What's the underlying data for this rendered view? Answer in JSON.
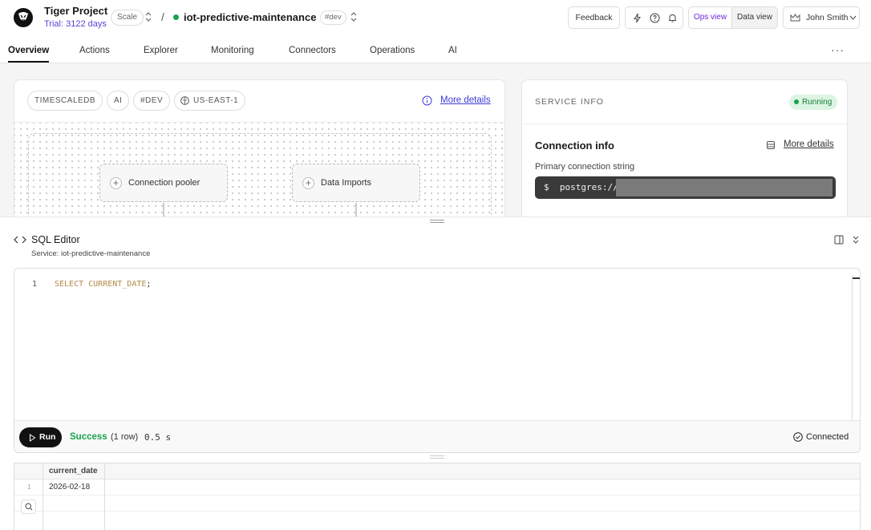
{
  "header": {
    "project_name": "Tiger Project",
    "trial": "Trial: 3122 days",
    "plan": "Scale",
    "separator": "/",
    "service_name": "iot-predictive-maintenance",
    "env": "#dev",
    "feedback_label": "Feedback",
    "ops_view_label": "Ops view",
    "data_view_label": "Data view",
    "user_name": "John Smith"
  },
  "tabs": [
    "Overview",
    "Actions",
    "Explorer",
    "Monitoring",
    "Connectors",
    "Operations",
    "AI"
  ],
  "overview": {
    "chips": [
      "TIMESCALEDB",
      "AI",
      "#DEV",
      "US-EAST-1"
    ],
    "more_details": "More details",
    "nodes": [
      "Connection pooler",
      "Data Imports"
    ]
  },
  "service_info": {
    "title": "SERVICE INFO",
    "status": "Running",
    "connection_title": "Connection info",
    "more_details": "More details",
    "primary_label": "Primary connection string",
    "prompt": "$",
    "conn_prefix": "postgres://"
  },
  "sql_editor": {
    "title": "SQL Editor",
    "service_line": "Service: iot-predictive-maintenance",
    "line_number": "1",
    "code": "SELECT CURRENT_DATE",
    "code_end": ";",
    "run_label": "Run",
    "status": "Success",
    "rows": "(1 row)",
    "time": "0.5 s",
    "connection_status": "Connected"
  },
  "results": {
    "columns": [
      "current_date"
    ],
    "rows": [
      {
        "index": "1",
        "values": [
          "2026-02-18"
        ]
      }
    ]
  },
  "colors": {
    "accent": "#6d28d9",
    "success": "#16a34a",
    "link": "#3b3bd6"
  }
}
